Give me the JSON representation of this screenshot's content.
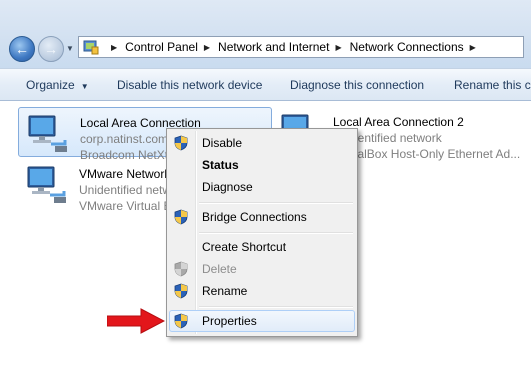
{
  "address": {
    "breadcrumbs": [
      "Control Panel",
      "Network and Internet",
      "Network Connections"
    ]
  },
  "toolbar": {
    "organize": "Organize",
    "disable": "Disable this network device",
    "diagnose": "Diagnose this connection",
    "rename": "Rename this conn"
  },
  "connections": [
    {
      "name": "Local Area Connection",
      "status": "corp.natinst.com",
      "device": "Broadcom NetXt"
    },
    {
      "name": "Local Area Connection 2",
      "status": "Unidentified network",
      "device": "VirtualBox Host-Only Ethernet Ad..."
    },
    {
      "name": "VMware Network",
      "status": "Unidentified netw",
      "device": "VMware Virtual E"
    }
  ],
  "context_menu": {
    "items": [
      {
        "label": "Disable",
        "shield": true
      },
      {
        "label": "Status",
        "bold": true
      },
      {
        "label": "Diagnose"
      },
      {
        "label": "Bridge Connections",
        "shield": true
      },
      {
        "label": "Create Shortcut"
      },
      {
        "label": "Delete",
        "shield": true,
        "disabled": true
      },
      {
        "label": "Rename",
        "shield": true
      },
      {
        "label": "Properties",
        "shield": true,
        "highlighted": true
      }
    ]
  },
  "colors": {
    "toolbar_text": "#1e395b",
    "selection_border": "#84acdd",
    "annotation_arrow": "#e3161b"
  },
  "icons": {
    "back": "back-arrow-icon",
    "forward": "forward-arrow-icon",
    "network": "network-connection-icon",
    "shield": "uac-shield-icon"
  }
}
